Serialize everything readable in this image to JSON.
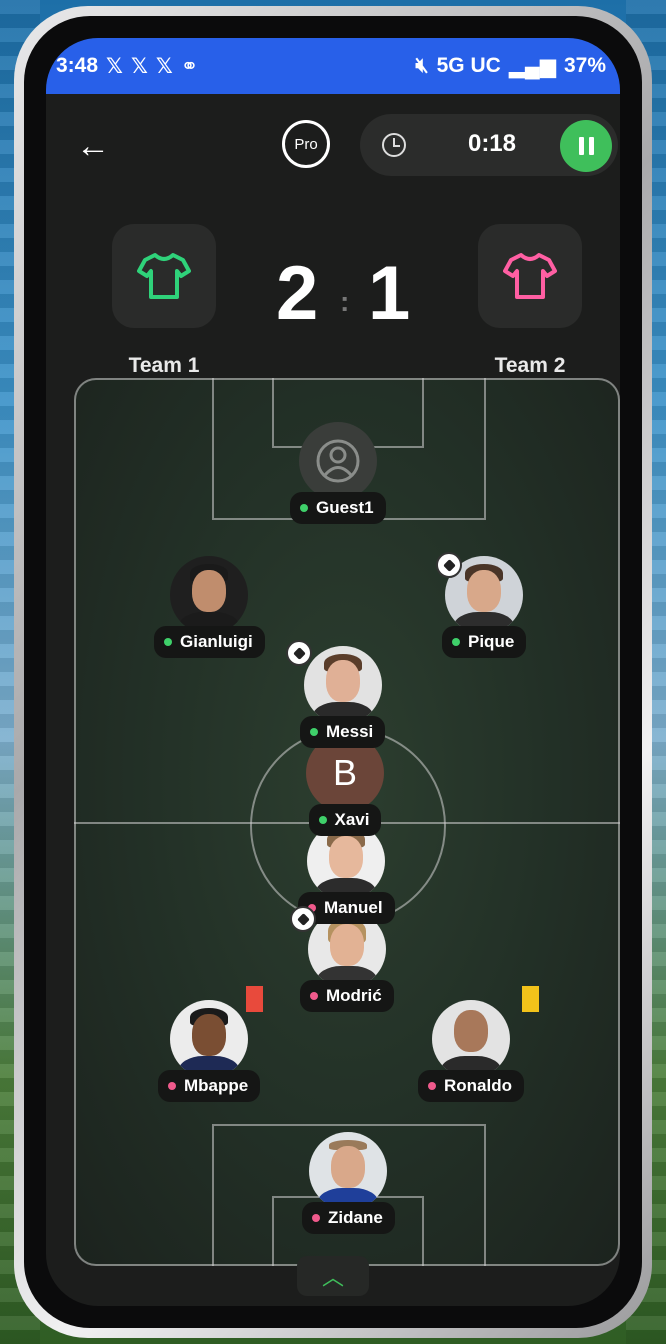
{
  "status_bar": {
    "time": "3:48",
    "left_icons": [
      "x-icon",
      "x-icon",
      "x-icon",
      "link-icon"
    ],
    "network": "5G UC",
    "battery": "37%"
  },
  "header": {
    "back_icon": "back-arrow-icon",
    "pro_label": "Pro",
    "timer": "0:18",
    "pause_icon": "pause-icon"
  },
  "score": {
    "team1": {
      "name": "Team 1",
      "goals": "2",
      "color": "#2fd27a"
    },
    "separator": ":",
    "team2": {
      "name": "Team 2",
      "goals": "1",
      "color": "#ff5fa3"
    }
  },
  "players": [
    {
      "name": "Guest1",
      "team": 1,
      "avatar": "guest-icon"
    },
    {
      "name": "Gianluigi",
      "team": 1
    },
    {
      "name": "Pique",
      "team": 1,
      "scored": true
    },
    {
      "name": "Messi",
      "team": 1,
      "scored": true
    },
    {
      "name": "Xavi",
      "team": 1,
      "initial": "B"
    },
    {
      "name": "Manuel",
      "team": 2
    },
    {
      "name": "Modrić",
      "team": 2,
      "scored": true
    },
    {
      "name": "Mbappe",
      "team": 2,
      "card": "red"
    },
    {
      "name": "Ronaldo",
      "team": 2,
      "card": "yellow"
    },
    {
      "name": "Zidane",
      "team": 2
    }
  ],
  "colors": {
    "team1_dot": "#3fd06a",
    "team2_dot": "#f05a8c",
    "status_bar": "#2860e9",
    "pause_button": "#3fbf5b",
    "red_card": "#e84a3c",
    "yellow_card": "#f2c21a"
  }
}
